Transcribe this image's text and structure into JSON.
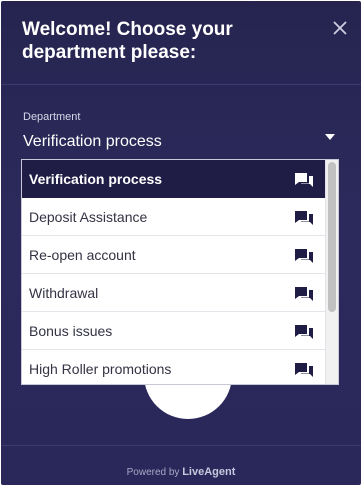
{
  "header": {
    "title": "Welcome! Choose your department please:",
    "close_icon": "close-icon"
  },
  "department": {
    "label": "Department",
    "selected": "Verification process",
    "arrow_icon": "caret-down-icon",
    "options": [
      {
        "label": "Verification process",
        "icon": "chat-icon",
        "selected": true
      },
      {
        "label": "Deposit Assistance",
        "icon": "chat-icon",
        "selected": false
      },
      {
        "label": "Re-open account",
        "icon": "chat-icon",
        "selected": false
      },
      {
        "label": "Withdrawal",
        "icon": "chat-icon",
        "selected": false
      },
      {
        "label": "Bonus issues",
        "icon": "chat-icon",
        "selected": false
      },
      {
        "label": "High Roller promotions",
        "icon": "chat-icon",
        "selected": false
      }
    ]
  },
  "footer": {
    "powered_by": "Powered by ",
    "brand": "LiveAgent"
  },
  "colors": {
    "background": "#2a285a",
    "selected_option": "#1f1d46",
    "text_on_dark": "#ffffff",
    "option_text": "#333344"
  }
}
